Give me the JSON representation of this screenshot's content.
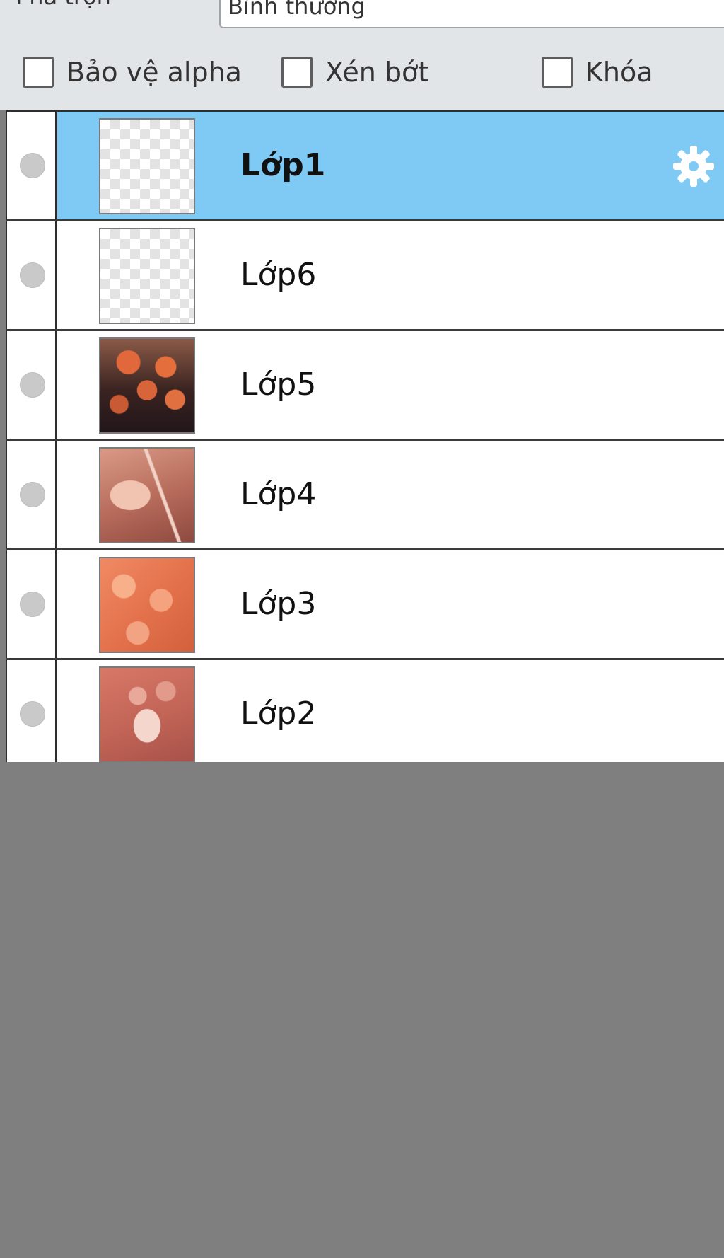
{
  "blend": {
    "label": "Pha trộn",
    "value": "Bình thường"
  },
  "options": {
    "alpha_protect": {
      "label": "Bảo vệ alpha",
      "checked": false
    },
    "clip": {
      "label": "Xén bớt",
      "checked": false
    },
    "lock": {
      "label": "Khóa",
      "checked": false
    }
  },
  "layers": [
    {
      "name": "Lớp1",
      "selected": true,
      "thumbnail": "transparent",
      "icon": "gear-icon"
    },
    {
      "name": "Lớp6",
      "selected": false,
      "thumbnail": "transparent"
    },
    {
      "name": "Lớp5",
      "selected": false,
      "thumbnail": "flowers-dark"
    },
    {
      "name": "Lớp4",
      "selected": false,
      "thumbnail": "pink-still-life"
    },
    {
      "name": "Lớp3",
      "selected": false,
      "thumbnail": "orange-petals"
    },
    {
      "name": "Lớp2",
      "selected": false,
      "thumbnail": "teacup"
    }
  ],
  "colors": {
    "selected_row": "#7fcaf5",
    "empty_area": "#7f7f7f",
    "toolbar_bg": "#e2e5e8"
  }
}
